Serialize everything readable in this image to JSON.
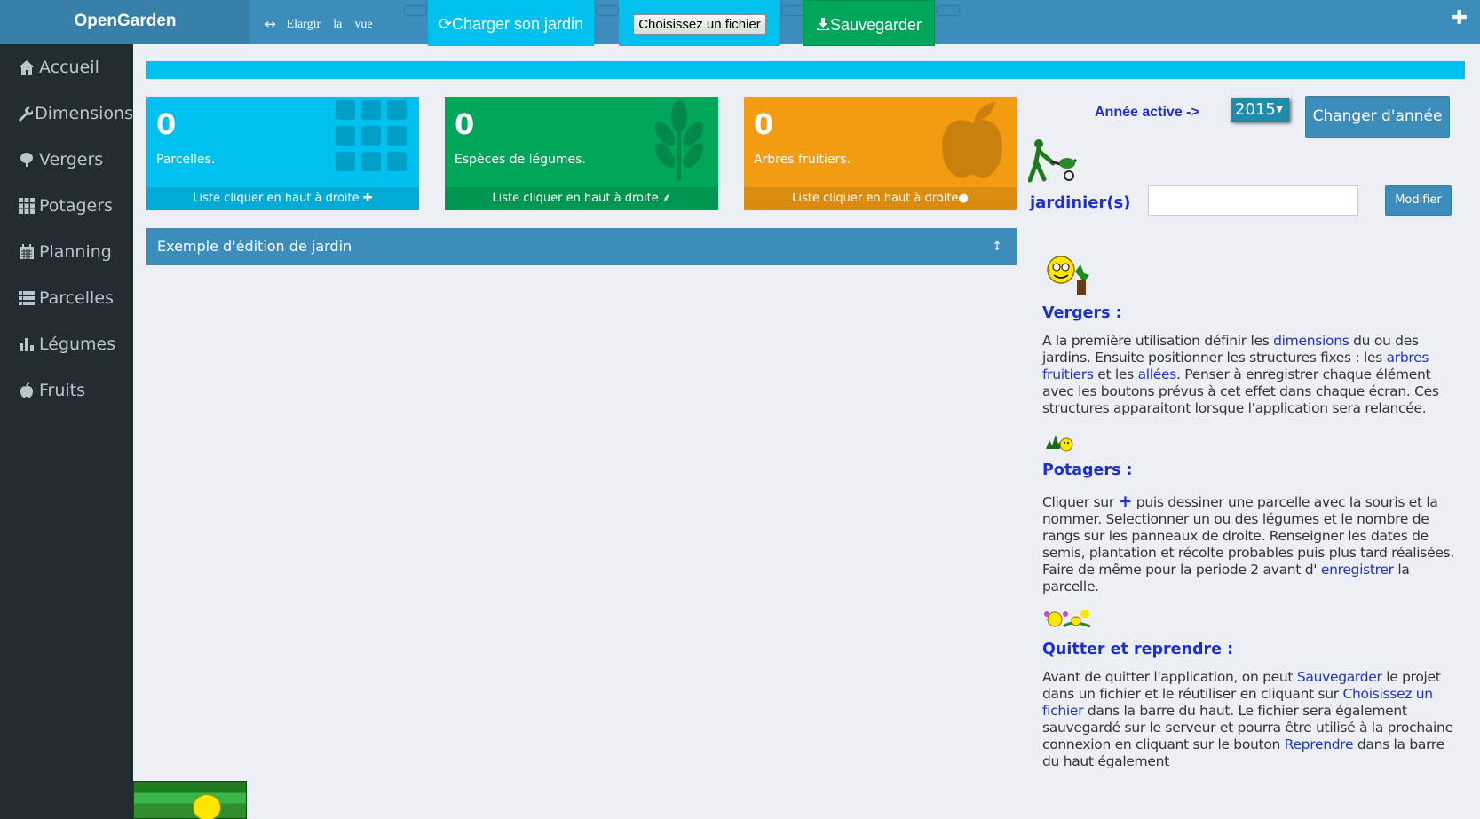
{
  "brand": "OpenGarden",
  "toolbar": {
    "widen_words": [
      "Elargir",
      "la",
      "vue"
    ],
    "load_label": "Charger son jardin",
    "choose_file_label": "Choisissez un fichier",
    "save_label": "Sauvegarder",
    "add_icon": "plus-icon"
  },
  "sidebar": {
    "items": [
      {
        "label": "Accueil",
        "icon": "home-icon"
      },
      {
        "label": "Dimensions",
        "icon": "wrench-icon"
      },
      {
        "label": "Vergers",
        "icon": "tree-icon"
      },
      {
        "label": "Potagers",
        "icon": "grid-icon"
      },
      {
        "label": "Planning",
        "icon": "calendar-icon"
      },
      {
        "label": "Parcelles",
        "icon": "list-icon"
      },
      {
        "label": "Légumes",
        "icon": "bar-chart-icon"
      },
      {
        "label": "Fruits",
        "icon": "apple-icon"
      }
    ]
  },
  "stats": [
    {
      "value": "0",
      "label": "Parcelles.",
      "footer": "Liste cliquer en haut à droite",
      "color": "#00c0ef"
    },
    {
      "value": "0",
      "label": "Espèces de légumes.",
      "footer": "Liste cliquer en haut à droite",
      "color": "#00a65a"
    },
    {
      "value": "0",
      "label": "Arbres fruitiers.",
      "footer": "Liste cliquer en haut à droite",
      "color": "#f39c12"
    }
  ],
  "panel": {
    "title": "Exemple d'édition de jardin"
  },
  "year": {
    "label": "Année active ->",
    "selected": "2015",
    "change_label": "Changer d'année"
  },
  "gardener": {
    "label": "jardinier(s)",
    "value": "",
    "modify_label": "Modifier"
  },
  "help": {
    "vergers": {
      "title": "Vergers :",
      "t1": "A la première utilisation définir les ",
      "l1": "dimensions",
      "t2": " du ou des jardins. Ensuite positionner les structures fixes : les ",
      "l2": "arbres fruitiers",
      "t3": " et les ",
      "l3": "allées",
      "t4": ". Penser à enregistrer chaque élément avec les boutons prévus à cet effet dans chaque écran. Ces structures apparaitont lorsque l'application sera relancée."
    },
    "potagers": {
      "title": "Potagers :",
      "t1": "Cliquer sur ",
      "l1": "+",
      "t2": " puis dessiner une parcelle avec la souris et la nommer. Selectionner un ou des légumes et le nombre de rangs sur les panneaux de droite. Renseigner les dates de semis, plantation et récolte probables puis plus tard réalisées. Faire de même pour la periode 2 avant d' ",
      "l2": "enregistrer",
      "t3": " la parcelle."
    },
    "quitter": {
      "title": "Quitter et reprendre :",
      "t1": "Avant de quitter l'application, on peut ",
      "l1": "Sauvegarder",
      "t2": " le projet dans un fichier et le réutiliser en cliquant sur ",
      "l2": "Choisissez un fichier",
      "t3": " dans la barre du haut. Le fichier sera également sauvegardé sur le serveur et pourra être utilisé à la prochaine connexion en cliquant sur le bouton ",
      "l3": "Reprendre",
      "t4": " dans la barre du haut également"
    }
  },
  "colors": {
    "primary": "#3c8dbc",
    "info": "#00c0ef",
    "success": "#00a65a",
    "warning": "#f39c12",
    "sidebar": "#222d32",
    "link": "#1e2fd1"
  }
}
